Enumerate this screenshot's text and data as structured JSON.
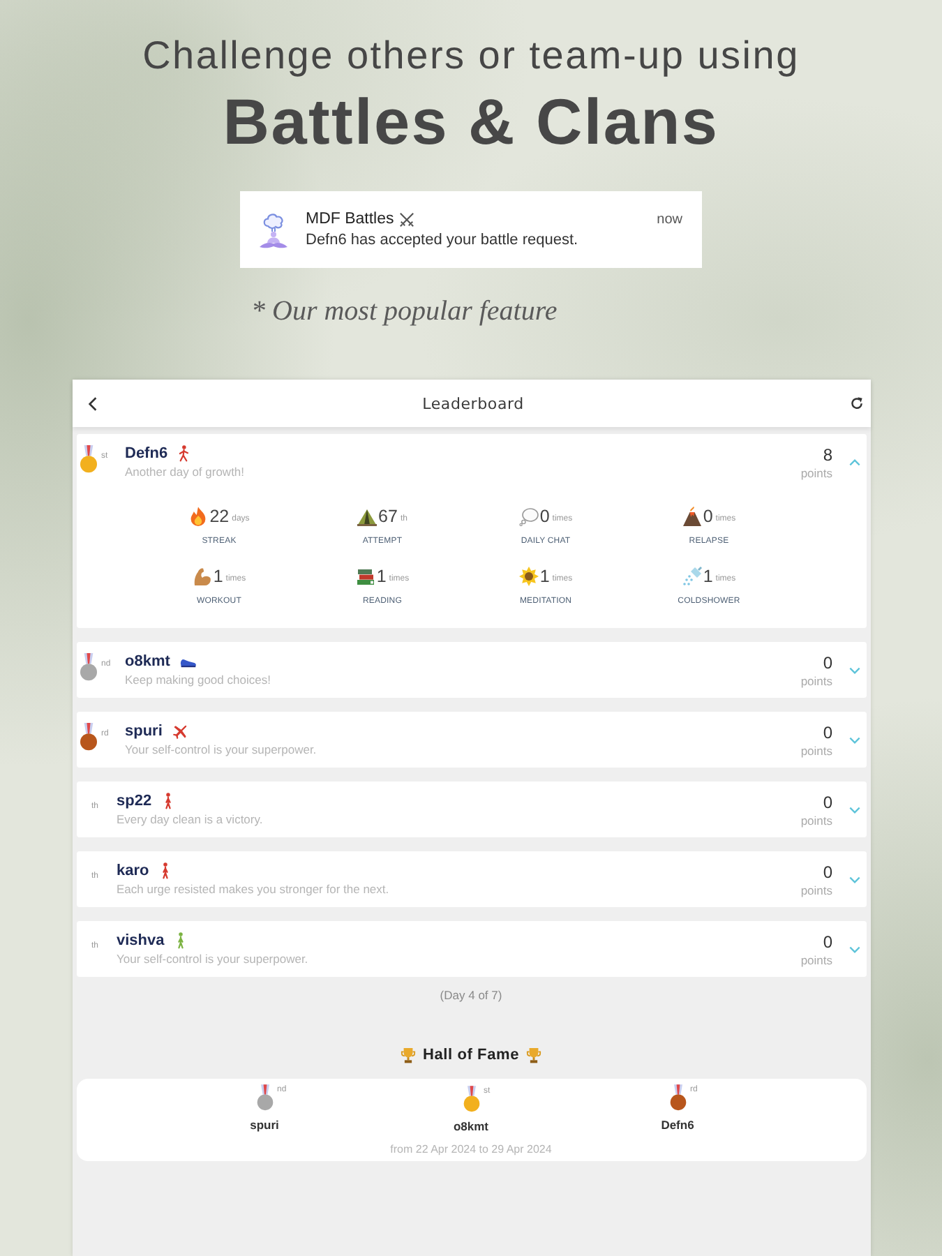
{
  "headline": {
    "line_1": "Challenge others or team-up using",
    "line_2": "Battles & Clans"
  },
  "notification": {
    "app_name": "MDF Battles",
    "time": "now",
    "message": "Defn6 has accepted your battle request."
  },
  "note": "* Our most popular feature",
  "leaderboard": {
    "title": "Leaderboard",
    "members": [
      {
        "rank_suffix": "st",
        "color": "#f2b01e",
        "name": "Defn6",
        "motto": "Another day of growth!",
        "points": "8",
        "points_label": "points",
        "expanded": true,
        "stats": [
          {
            "value": "22",
            "unit": "days",
            "label": "STREAK"
          },
          {
            "value": "67",
            "unit": "th",
            "label": "ATTEMPT"
          },
          {
            "value": "0",
            "unit": "times",
            "label": "DAILY CHAT"
          },
          {
            "value": "0",
            "unit": "times",
            "label": "RELAPSE"
          },
          {
            "value": "1",
            "unit": "times",
            "label": "WORKOUT"
          },
          {
            "value": "1",
            "unit": "times",
            "label": "READING"
          },
          {
            "value": "1",
            "unit": "times",
            "label": "MEDITATION"
          },
          {
            "value": "1",
            "unit": "times",
            "label": "COLDSHOWER"
          }
        ]
      },
      {
        "rank_suffix": "nd",
        "color": "#a8a8a8",
        "name": "o8kmt",
        "motto": "Keep making good choices!",
        "points": "0",
        "points_label": "points",
        "expanded": false
      },
      {
        "rank_suffix": "rd",
        "color": "#b8561c",
        "name": "spuri",
        "motto": "Your self-control is your superpower.",
        "points": "0",
        "points_label": "points",
        "expanded": false
      },
      {
        "rank_suffix": "th",
        "name": "sp22",
        "motto": "Every day clean is a victory.",
        "points": "0",
        "points_label": "points",
        "expanded": false
      },
      {
        "rank_suffix": "th",
        "name": "karo",
        "motto": "Each urge resisted makes you stronger for the next.",
        "points": "0",
        "points_label": "points",
        "expanded": false
      },
      {
        "rank_suffix": "th",
        "name": "vishva",
        "motto": "Your self-control is your superpower.",
        "points": "0",
        "points_label": "points",
        "expanded": false
      }
    ],
    "day_caption": "(Day 4 of 7)"
  },
  "hall_of_fame": {
    "title": "Hall of Fame",
    "entries": [
      {
        "name": "spuri",
        "color": "#a8a8a8",
        "rank_suffix": "nd"
      },
      {
        "name": "o8kmt",
        "color": "#f2b01e",
        "rank_suffix": "st"
      },
      {
        "name": "Defn6",
        "color": "#b8561c",
        "rank_suffix": "rd"
      }
    ],
    "period": "from 22 Apr 2024 to 29 Apr 2024"
  }
}
